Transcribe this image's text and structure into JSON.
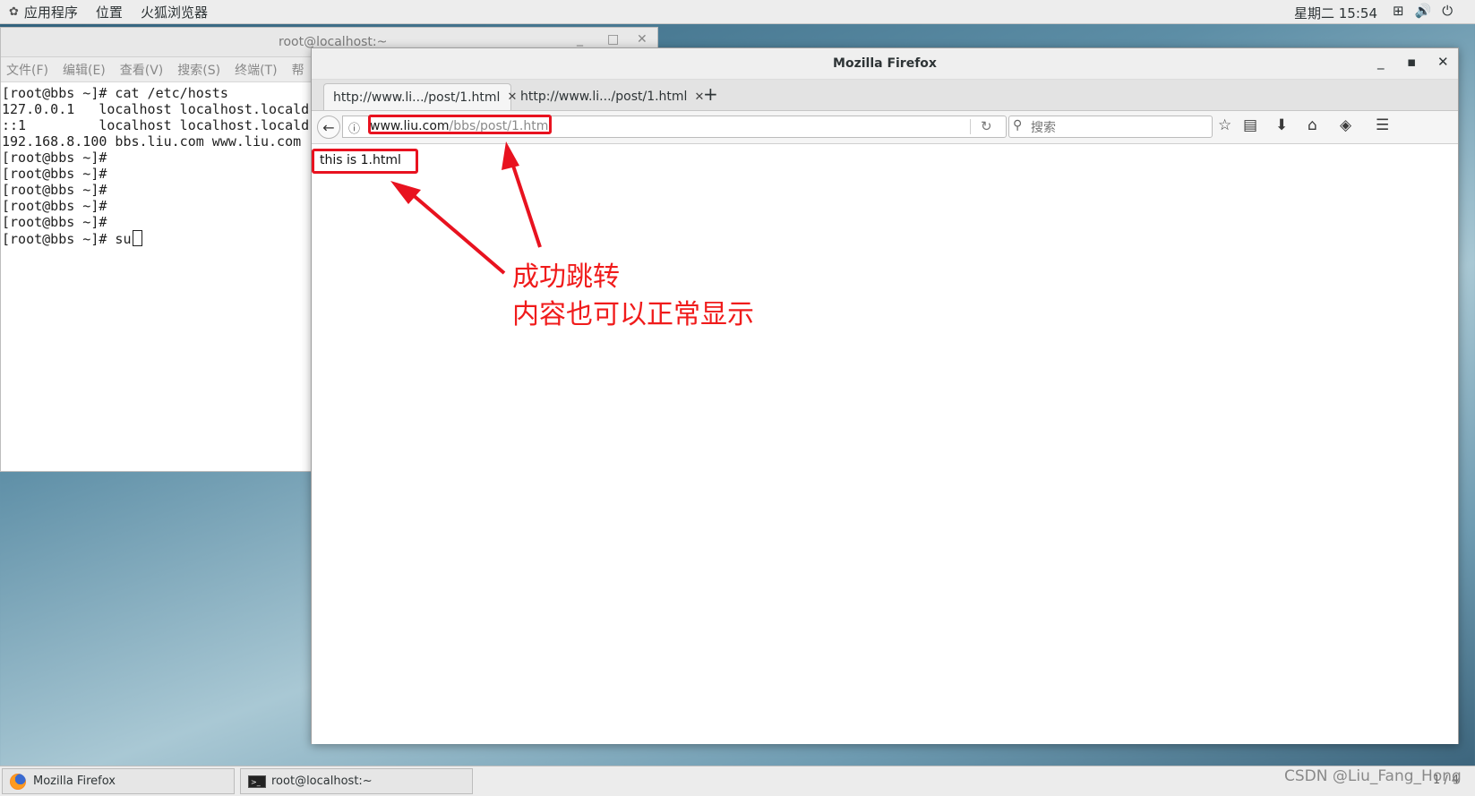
{
  "top_panel": {
    "menus": [
      "应用程序",
      "位置",
      "火狐浏览器"
    ],
    "clock": "星期二 15:54"
  },
  "terminal": {
    "title": "root@localhost:~",
    "menus": [
      "文件(F)",
      "编辑(E)",
      "查看(V)",
      "搜索(S)",
      "终端(T)",
      "帮"
    ],
    "lines": [
      "[root@bbs ~]# cat /etc/hosts",
      "127.0.0.1   localhost localhost.locald",
      "::1         localhost localhost.locald",
      "192.168.8.100 bbs.liu.com www.liu.com",
      "[root@bbs ~]#",
      "[root@bbs ~]#",
      "[root@bbs ~]#",
      "[root@bbs ~]#",
      "[root@bbs ~]#",
      "[root@bbs ~]# su"
    ]
  },
  "firefox": {
    "title": "Mozilla Firefox",
    "tabs": [
      {
        "label": "http://www.li.../post/1.html"
      },
      {
        "label": "http://www.li.../post/1.html"
      }
    ],
    "url_domain": "www.liu.com",
    "url_path": "/bbs/post/1.html",
    "search_placeholder": "搜索",
    "page_text": "this  is  1.html"
  },
  "annotation": {
    "line1": "成功跳转",
    "line2": "内容也可以正常显示",
    "color": "#f01b1b"
  },
  "taskbar": {
    "items": [
      "Mozilla Firefox",
      "root@localhost:~"
    ],
    "workspace": "1 / 4"
  },
  "watermark": "CSDN @Liu_Fang_Hong"
}
